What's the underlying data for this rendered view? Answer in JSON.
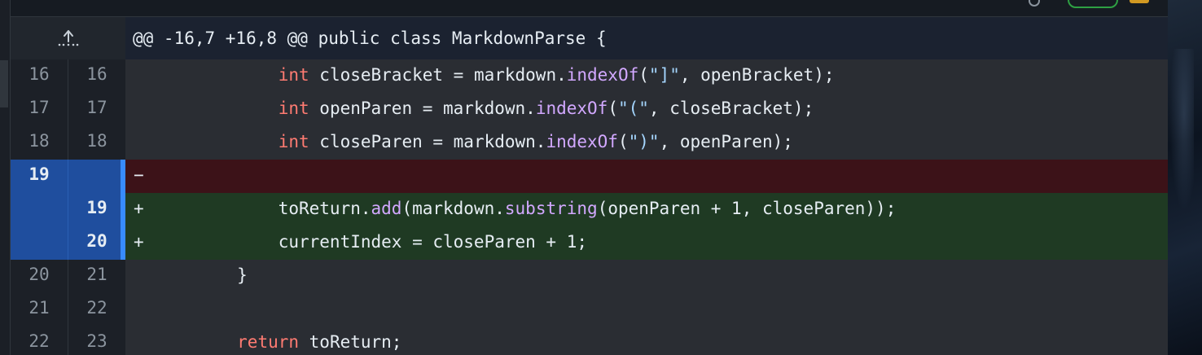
{
  "hunk": {
    "expand_icon": "expand-up-icon",
    "header": "@@ -16,7 +16,8 @@ public class MarkdownParse {"
  },
  "colors": {
    "keyword": "#ff7b72",
    "function": "#d2a8ff",
    "string": "#a5d6ff",
    "deletion_bg": "#3c1218",
    "addition_bg": "#1f3a23",
    "selection_blue": "#1f4e9e"
  },
  "rows": [
    {
      "old": "16",
      "new": "16",
      "marker": "",
      "tokens": [
        {
          "t": "            ",
          "c": "pl"
        },
        {
          "t": "int",
          "c": "kw"
        },
        {
          "t": " closeBracket = markdown.",
          "c": "pl"
        },
        {
          "t": "indexOf",
          "c": "fn"
        },
        {
          "t": "(",
          "c": "pl"
        },
        {
          "t": "\"]\"",
          "c": "st"
        },
        {
          "t": ", openBracket);",
          "c": "pl"
        }
      ]
    },
    {
      "old": "17",
      "new": "17",
      "marker": "",
      "tokens": [
        {
          "t": "            ",
          "c": "pl"
        },
        {
          "t": "int",
          "c": "kw"
        },
        {
          "t": " openParen = markdown.",
          "c": "pl"
        },
        {
          "t": "indexOf",
          "c": "fn"
        },
        {
          "t": "(",
          "c": "pl"
        },
        {
          "t": "\"(\"",
          "c": "st"
        },
        {
          "t": ", closeBracket);",
          "c": "pl"
        }
      ]
    },
    {
      "old": "18",
      "new": "18",
      "marker": "",
      "tokens": [
        {
          "t": "            ",
          "c": "pl"
        },
        {
          "t": "int",
          "c": "kw"
        },
        {
          "t": " closeParen = markdown.",
          "c": "pl"
        },
        {
          "t": "indexOf",
          "c": "fn"
        },
        {
          "t": "(",
          "c": "pl"
        },
        {
          "t": "\")\"",
          "c": "st"
        },
        {
          "t": ", openParen);",
          "c": "pl"
        }
      ]
    },
    {
      "old": "19",
      "new": "",
      "marker": "−",
      "tokens": []
    },
    {
      "old": "",
      "new": "19",
      "marker": "+",
      "tokens": [
        {
          "t": "            toReturn.",
          "c": "pl"
        },
        {
          "t": "add",
          "c": "fn"
        },
        {
          "t": "(markdown.",
          "c": "pl"
        },
        {
          "t": "substring",
          "c": "fn"
        },
        {
          "t": "(openParen + 1, closeParen));",
          "c": "pl"
        }
      ]
    },
    {
      "old": "",
      "new": "20",
      "marker": "+",
      "tokens": [
        {
          "t": "            currentIndex = closeParen + 1;",
          "c": "pl"
        }
      ]
    },
    {
      "old": "20",
      "new": "21",
      "marker": "",
      "tokens": [
        {
          "t": "        }",
          "c": "pl"
        }
      ]
    },
    {
      "old": "21",
      "new": "22",
      "marker": "",
      "tokens": []
    },
    {
      "old": "22",
      "new": "23",
      "marker": "",
      "tokens": [
        {
          "t": "        ",
          "c": "pl"
        },
        {
          "t": "return",
          "c": "kw"
        },
        {
          "t": " toReturn;",
          "c": "pl"
        }
      ]
    }
  ]
}
